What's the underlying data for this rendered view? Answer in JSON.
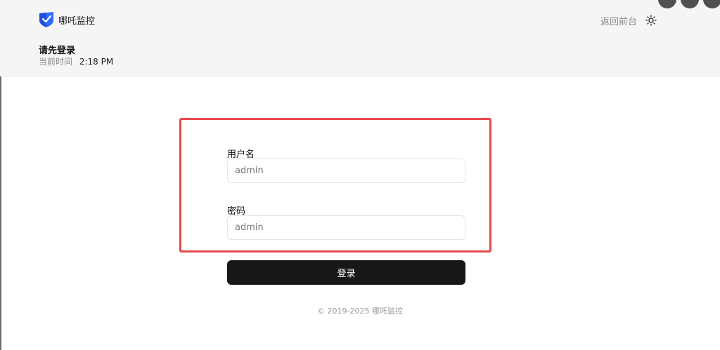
{
  "header": {
    "brand_name": "哪吒监控",
    "back_link": "返回前台",
    "heading": "请先登录",
    "time_label": "当前时间",
    "time_value": "2:18 PM",
    "theme_icon": "sun-icon",
    "logo_icon": "shield-check-icon"
  },
  "login_form": {
    "username_label": "用户名",
    "username_value": "",
    "username_placeholder": "admin",
    "password_label": "密码",
    "password_value": "",
    "password_placeholder": "admin",
    "submit_label": "登录"
  },
  "footer": {
    "copyright": "© 2019-2025 哪吒监控"
  },
  "colors": {
    "header_bg": "#f5f5f5",
    "button_bg": "#171717",
    "highlight": "#e5484d",
    "brand_blue": "#2f6bff"
  }
}
